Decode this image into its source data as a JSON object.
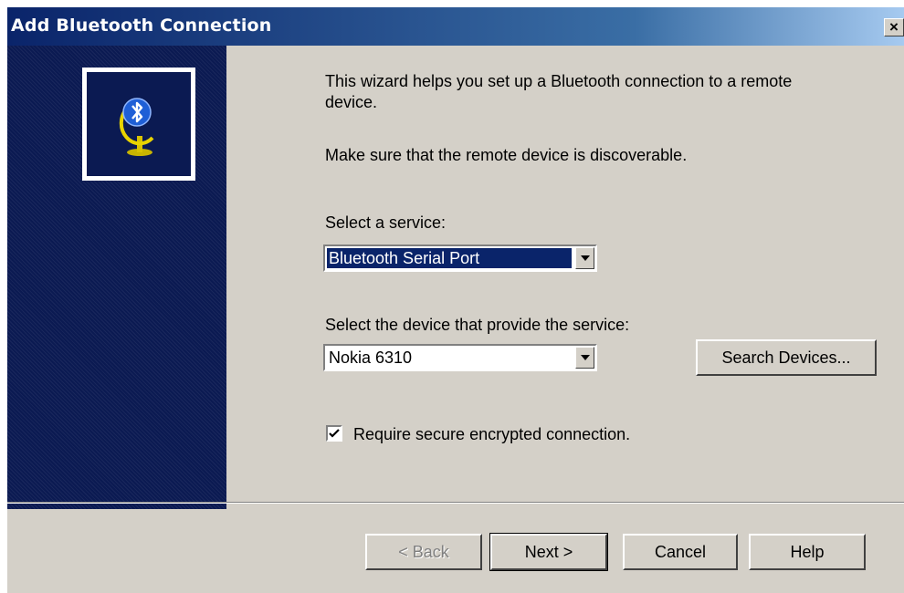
{
  "window": {
    "title": "Add Bluetooth Connection",
    "close_label": "×"
  },
  "intro": {
    "line1": "This wizard helps you set up a Bluetooth connection to a remote",
    "line2": "device.",
    "discoverable": "Make sure that the remote device is discoverable."
  },
  "service": {
    "label": "Select a service:",
    "value": "Bluetooth Serial Port"
  },
  "device": {
    "label": "Select the device that provide the service:",
    "value": "Nokia 6310"
  },
  "search_button": "Search Devices...",
  "secure": {
    "label": "Require secure encrypted connection.",
    "checked": true
  },
  "buttons": {
    "back": "< Back",
    "next": "Next >",
    "cancel": "Cancel",
    "help": "Help"
  },
  "colors": {
    "title_bar_start": "#0a246a",
    "sidebar": "#0b1a52",
    "dialog_face": "#d4d0c8",
    "selection": "#0a246a"
  },
  "icons": {
    "logo": "bluetooth-globe-icon",
    "dropdown": "chevron-down-icon",
    "check": "check-icon"
  }
}
